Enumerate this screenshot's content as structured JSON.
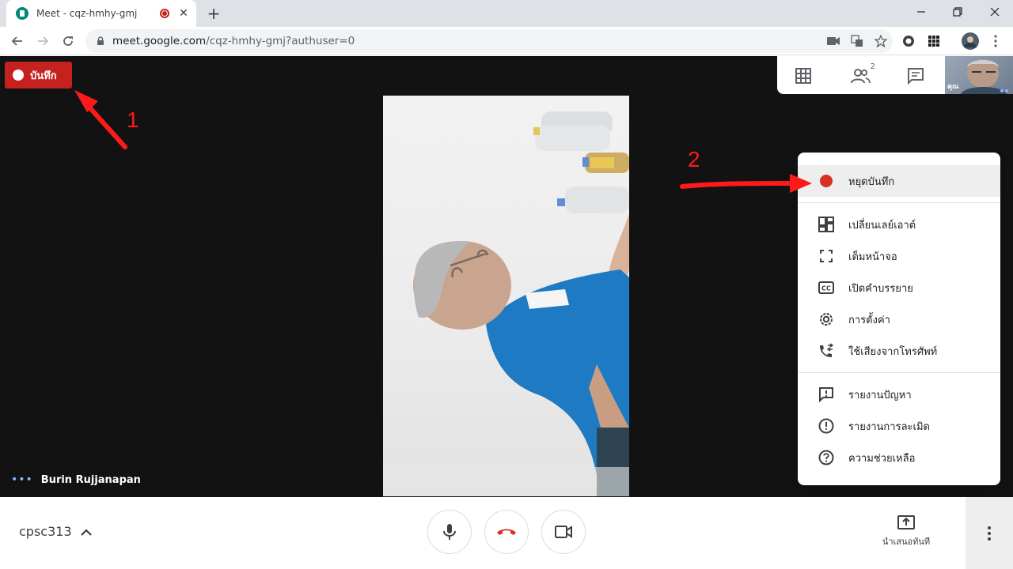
{
  "browser": {
    "tab_title": "Meet - cqz-hmhy-gmj",
    "tab_close": "✕",
    "new_tab": "+",
    "url_main": "meet.google.com",
    "url_path": "/cqz-hmhy-gmj?authuser=0"
  },
  "meet": {
    "recording_badge": "บันทึก",
    "self_label": "คุณ",
    "participant_count": "2",
    "speaker_name": "Burin Rujjanapan",
    "meeting_code": "cpsc313",
    "present_label": "นำเสนอทันที"
  },
  "menu": {
    "items": [
      {
        "label": "หยุดบันทึก",
        "icon": "record-dot-icon"
      },
      {
        "label": "เปลี่ยนเลย์เอาต์",
        "icon": "layout-icon"
      },
      {
        "label": "เต็มหน้าจอ",
        "icon": "fullscreen-icon"
      },
      {
        "label": "เปิดคำบรรยาย",
        "icon": "captions-icon"
      },
      {
        "label": "การตั้งค่า",
        "icon": "settings-gear-icon"
      },
      {
        "label": "ใช้เสียงจากโทรศัพท์",
        "icon": "phone-audio-icon"
      },
      {
        "label": "รายงานปัญหา",
        "icon": "report-problem-icon"
      },
      {
        "label": "รายงานการละเมิด",
        "icon": "report-abuse-icon"
      },
      {
        "label": "ความช่วยเหลือ",
        "icon": "help-icon"
      }
    ]
  },
  "annotations": {
    "step1": "1",
    "step2": "2"
  },
  "colors": {
    "record_red": "#c5221f",
    "annotation_red": "#ff1a1a",
    "stage_bg": "#121212",
    "hangup_red": "#d93025"
  }
}
